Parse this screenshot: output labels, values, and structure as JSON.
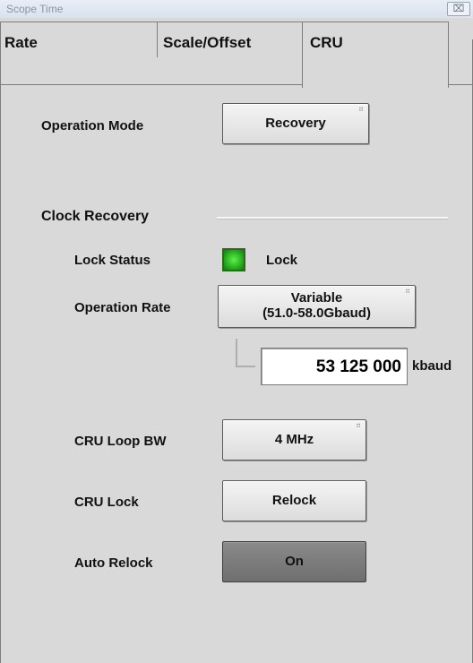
{
  "window": {
    "title": "Scope Time",
    "close_icon": "⌧"
  },
  "tabs": [
    {
      "label": "Rate"
    },
    {
      "label": "Scale/Offset"
    },
    {
      "label": "CRU"
    }
  ],
  "operation_mode": {
    "label": "Operation Mode",
    "value": "Recovery"
  },
  "clock_recovery": {
    "heading": "Clock Recovery",
    "lock_status": {
      "label": "Lock Status",
      "text": "Lock",
      "led_color": "#1ea31a"
    },
    "operation_rate": {
      "label": "Operation Rate",
      "value_line1": "Variable",
      "value_line2": "(51.0-58.0Gbaud)",
      "numeric_value": "53 125 000",
      "unit": "kbaud"
    },
    "loop_bw": {
      "label": "CRU Loop BW",
      "value": "4 MHz"
    },
    "cru_lock": {
      "label": "CRU Lock",
      "button": "Relock"
    },
    "auto_relock": {
      "label": "Auto Relock",
      "value": "On"
    }
  }
}
